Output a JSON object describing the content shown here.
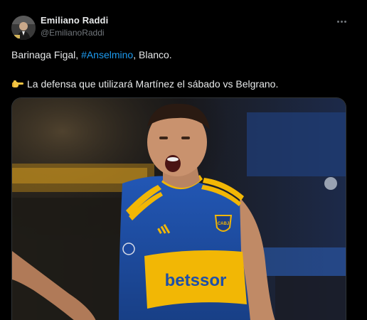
{
  "author": {
    "display_name": "Emiliano Raddi",
    "handle": "@EmilianoRaddi"
  },
  "post": {
    "line1_before": "Barinaga Figal, ",
    "hashtag": "#Anselmino",
    "line1_after": ", Blanco.",
    "line2_emoji": "👉",
    "line2_text": "La defensa que utilizará Martínez el sábado vs Belgrano."
  },
  "media": {
    "sponsor_text": "betssor",
    "crest_text": "CABJ",
    "description_icon": "photo"
  },
  "colors": {
    "background": "#000000",
    "text_primary": "#e7e9ea",
    "text_secondary": "#71767b",
    "hashtag": "#1d9bf0",
    "jersey_blue": "#1f4fa8",
    "jersey_gold": "#f2b705"
  },
  "icons": {
    "more": "more-horizontal-icon",
    "pointing": "pointing-right-emoji"
  }
}
